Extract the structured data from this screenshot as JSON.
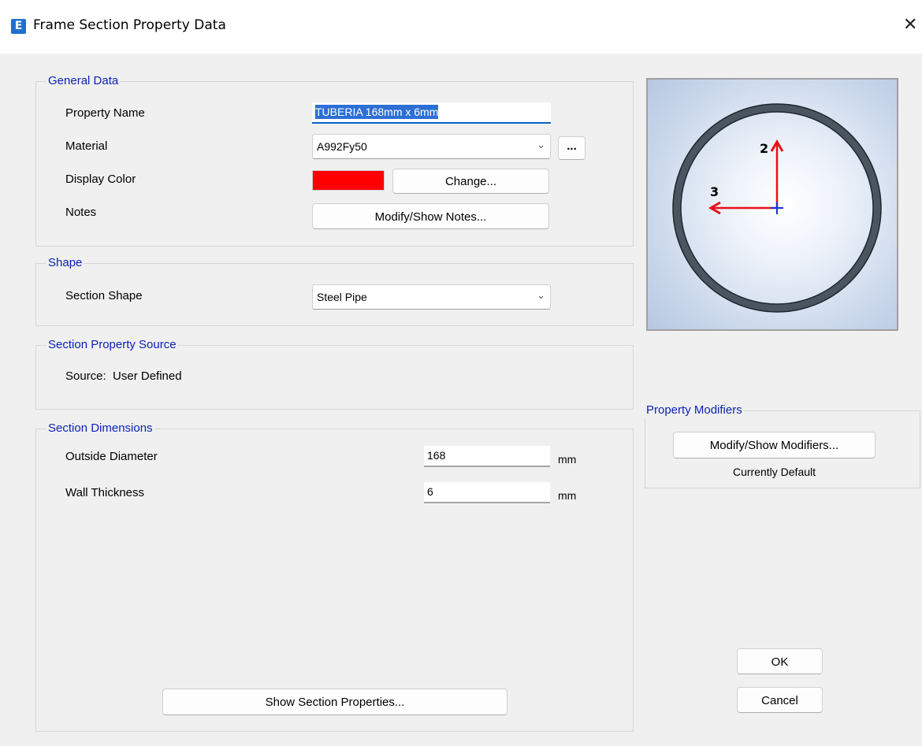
{
  "window": {
    "title": "Frame Section Property Data",
    "app_icon_glyph": "E",
    "close_glyph": "✕"
  },
  "general_data": {
    "group_label": "General Data",
    "property_name_label": "Property Name",
    "property_name_value": "TUBERIA 168mm x 6mm",
    "material_label": "Material",
    "material_value": "A992Fy50",
    "material_browse_label": "...",
    "display_color_label": "Display Color",
    "display_color_value": "#ff0000",
    "change_button_label": "Change...",
    "notes_label": "Notes",
    "notes_button_label": "Modify/Show Notes..."
  },
  "shape": {
    "group_label": "Shape",
    "section_shape_label": "Section Shape",
    "section_shape_value": "Steel Pipe"
  },
  "source": {
    "group_label": "Section Property Source",
    "source_text": "Source:  User Defined"
  },
  "dimensions": {
    "group_label": "Section Dimensions",
    "rows": [
      {
        "label": "Outside Diameter",
        "value": "168",
        "unit": "mm"
      },
      {
        "label": "Wall Thickness",
        "value": "6",
        "unit": "mm"
      }
    ],
    "show_properties_button_label": "Show Section Properties..."
  },
  "preview": {
    "axis_2_label": "2",
    "axis_3_label": "3",
    "axis_color": "#e8101c",
    "centroid_color": "#1a2fe0",
    "pipe_color": "#4a5560"
  },
  "modifiers": {
    "group_label": "Property Modifiers",
    "button_label": "Modify/Show Modifiers...",
    "status_text": "Currently Default"
  },
  "dialog_buttons": {
    "ok_label": "OK",
    "cancel_label": "Cancel"
  },
  "icons": [
    "app-e-icon",
    "close-icon",
    "chevron-down-icon",
    "section-preview-icon"
  ]
}
